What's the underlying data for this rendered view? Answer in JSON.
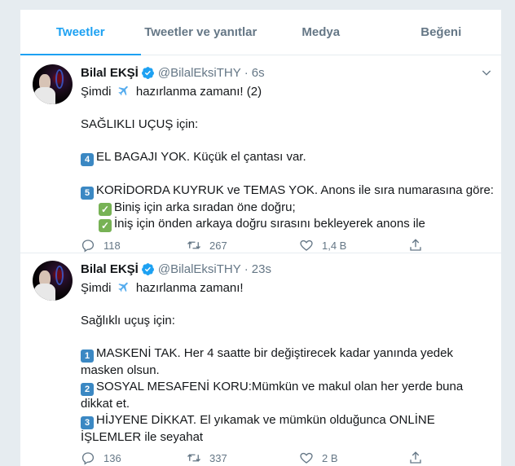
{
  "tabs": [
    "Tweetler",
    "Tweetler ve yanıtlar",
    "Medya",
    "Beğeni"
  ],
  "tweets": [
    {
      "name": "Bilal EKŞİ",
      "handle": "@BilalEksiTHY",
      "time": "6s",
      "l1a": "Şimdi",
      "l1b": "hazırlanma zamanı! (2)",
      "l2": "SAĞLIKLI UÇUŞ için:",
      "k4": "4",
      "l3": "EL BAGAJI YOK. Küçük el çantası var.",
      "k5": "5",
      "l4": "KORİDORDA KUYRUK ve TEMAS YOK. Anons ile sıra numarasına göre:",
      "l5": "Biniş için arka sıradan öne doğru;",
      "l6": "İniş için önden arkaya doğru sırasını bekleyerek anons ile",
      "replies": "118",
      "retweets": "267",
      "likes": "1,4 B"
    },
    {
      "name": "Bilal EKŞİ",
      "handle": "@BilalEksiTHY",
      "time": "23s",
      "l1a": "Şimdi",
      "l1b": "hazırlanma zamanı!",
      "l2": "Sağlıklı uçuş için:",
      "k1": "1",
      "l3": "MASKENİ TAK. Her 4 saatte bir değiştirecek kadar yanında yedek",
      "l3b": "masken olsun.",
      "k2": "2",
      "l4": "SOSYAL MESAFENİ KORU:Mümkün ve makul  olan her yerde buna",
      "l4b": "dikkat et.",
      "k3": "3",
      "l5": "HİJYENE DİKKAT. El yıkamak ve mümkün olduğunca  ONLİNE",
      "l5b": "İŞLEMLER ile seyahat",
      "replies": "136",
      "retweets": "337",
      "likes": "2 B"
    }
  ],
  "icons": {
    "verified": "verified-badge-icon",
    "plane": "airplane-emoji-icon",
    "reply": "reply-icon",
    "retweet": "retweet-icon",
    "like": "heart-icon",
    "share": "share-icon",
    "chevron": "chevron-down-icon"
  },
  "colors": {
    "accent": "#1da1f2",
    "muted": "#657786",
    "keycap": "#3b88c3",
    "check": "#77b255"
  }
}
